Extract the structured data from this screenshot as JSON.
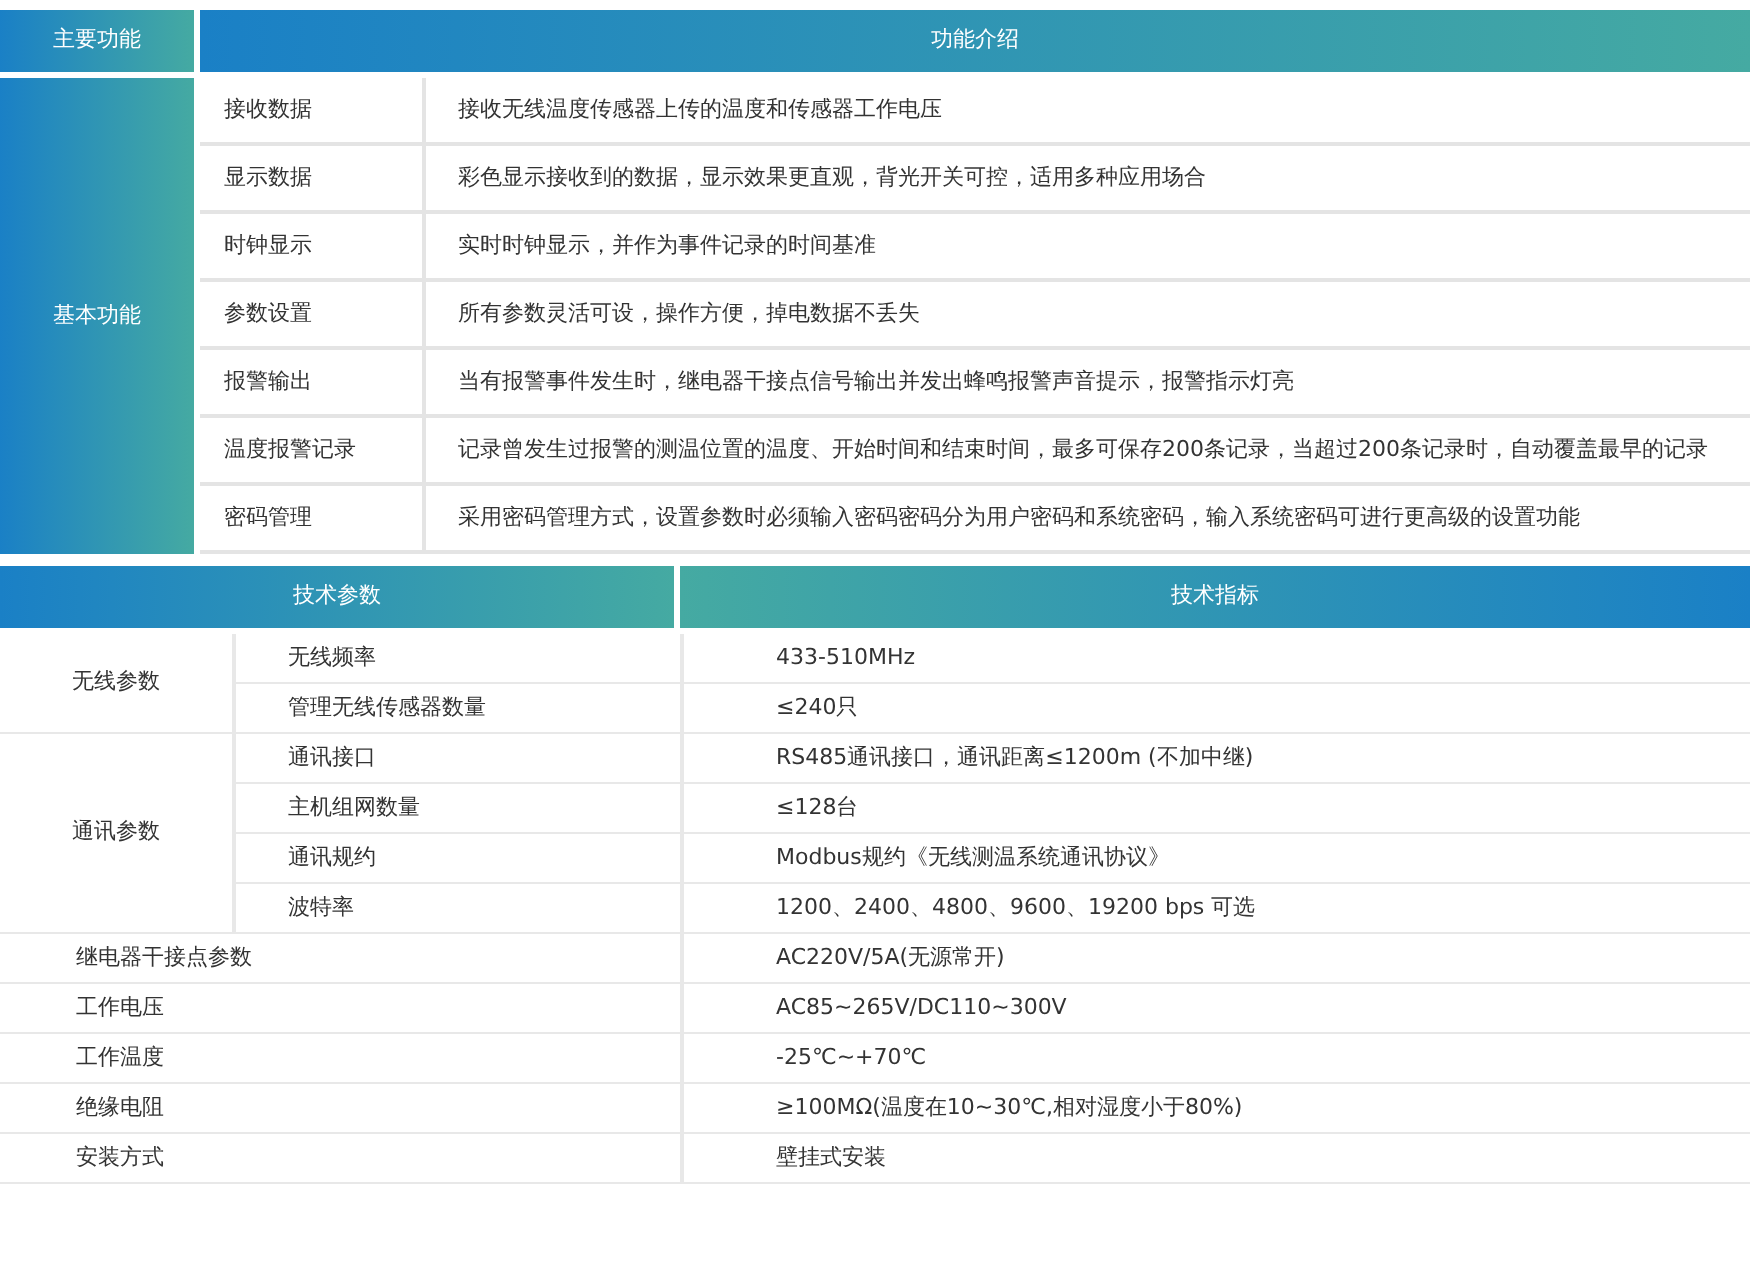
{
  "features": {
    "headers": [
      "主要功能",
      "功能介绍"
    ],
    "group": "基本功能",
    "rows": [
      {
        "name": "接收数据",
        "desc": "接收无线温度传感器上传的温度和传感器工作电压"
      },
      {
        "name": "显示数据",
        "desc": "彩色显示接收到的数据，显示效果更直观，背光开关可控，适用多种应用场合"
      },
      {
        "name": "时钟显示",
        "desc": "实时时钟显示，并作为事件记录的时间基准"
      },
      {
        "name": "参数设置",
        "desc": "所有参数灵活可设，操作方便，掉电数据不丢失"
      },
      {
        "name": "报警输出",
        "desc": "当有报警事件发生时，继电器干接点信号输出并发出蜂鸣报警声音提示，报警指示灯亮"
      },
      {
        "name": "温度报警记录",
        "desc": "记录曾发生过报警的测温位置的温度、开始时间和结束时间，最多可保存200条记录，当超过200条记录时，自动覆盖最早的记录"
      },
      {
        "name": "密码管理",
        "desc": "采用密码管理方式，设置参数时必须输入密码密码分为用户密码和系统密码，输入系统密码可进行更高级的设置功能"
      }
    ]
  },
  "specs": {
    "headers": [
      "技术参数",
      "技术指标"
    ],
    "rows": [
      {
        "kind": "group",
        "label": "无线参数",
        "items": [
          {
            "name": "无线频率",
            "value": "433-510MHz"
          },
          {
            "name": "管理无线传感器数量",
            "value": "≤240只"
          }
        ]
      },
      {
        "kind": "group",
        "label": "通讯参数",
        "items": [
          {
            "name": "通讯接口",
            "value": "RS485通讯接口，通讯距离≤1200m (不加中继)"
          },
          {
            "name": "主机组网数量",
            "value": "≤128台"
          },
          {
            "name": "通讯规约",
            "value": "Modbus规约《无线测温系统通讯协议》"
          },
          {
            "name": "波特率",
            "value": "1200、2400、4800、9600、19200 bps 可选"
          }
        ]
      },
      {
        "kind": "single",
        "name": "继电器干接点参数",
        "value": "AC220V/5A(无源常开)"
      },
      {
        "kind": "single",
        "name": "工作电压",
        "value": "AC85~265V/DC110~300V"
      },
      {
        "kind": "single",
        "name": "工作温度",
        "value": "-25℃~+70℃"
      },
      {
        "kind": "single",
        "name": "绝缘电阻",
        "value": "≥100MΩ(温度在10~30℃,相对湿度小于80%)"
      },
      {
        "kind": "single",
        "name": "安装方式",
        "value": "壁挂式安装"
      }
    ]
  }
}
